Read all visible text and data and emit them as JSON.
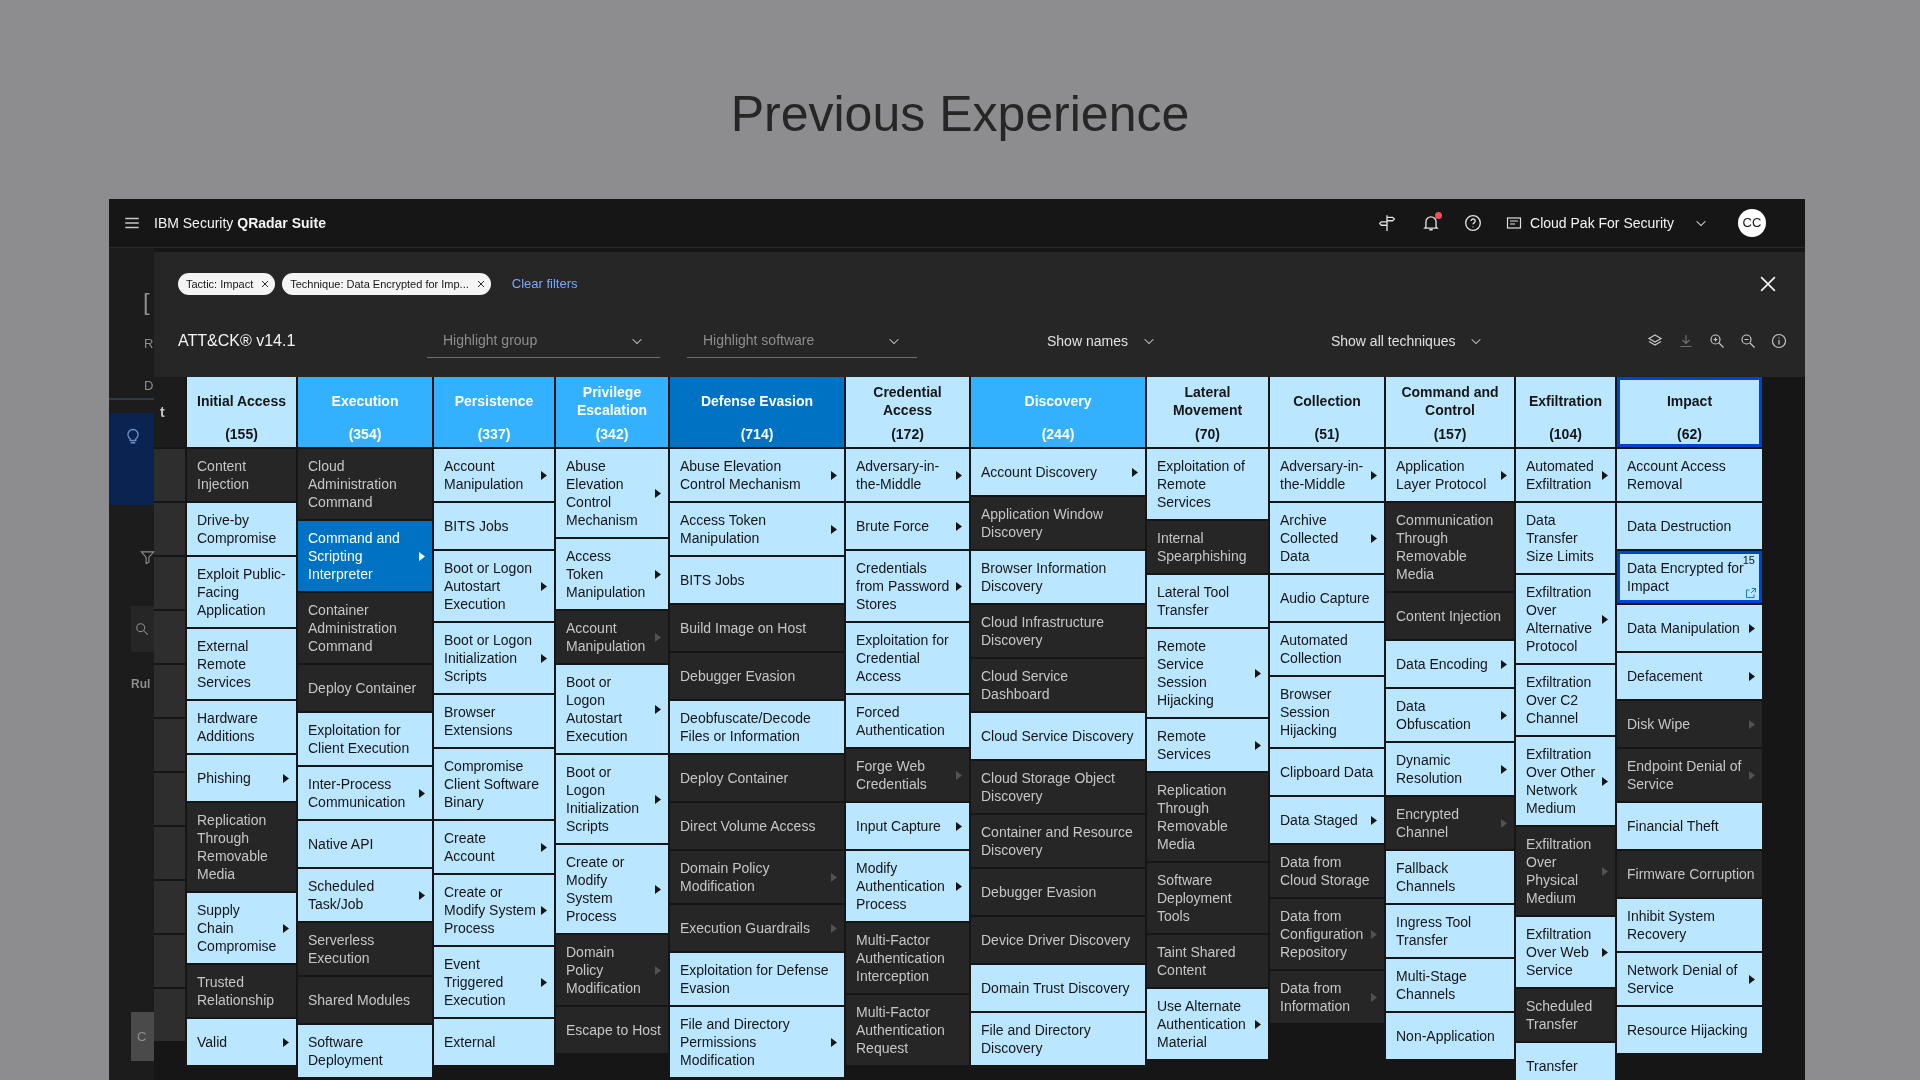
{
  "page_title": "Previous Experience",
  "app_bar": {
    "brand": "IBM Security **QRadar Suite**",
    "notification_unread": true,
    "context": "Cloud Pak For Security",
    "avatar": "CC"
  },
  "background_page": {
    "heading": "[",
    "label": "R",
    "tab": "D",
    "column_header": "Rul",
    "button": "C"
  },
  "filters": [
    {
      "label": "Tactic: Impact"
    },
    {
      "label": "Technique: Data Encrypted for Imp..."
    }
  ],
  "clear_filters": "Clear filters",
  "version": "ATT&CK® v14.1",
  "highlight_group": {
    "placeholder": "Highlight group"
  },
  "highlight_software": {
    "placeholder": "Highlight software"
  },
  "show_names": "Show names",
  "show_techniques": "Show all techniques",
  "cut_column_text": "t",
  "tactics": [
    {
      "name": "Initial Access",
      "count": "(155)",
      "color": "#bae6ff",
      "selected": false,
      "techniques": [
        {
          "name": "Content Injection",
          "color": "#262626",
          "selected": false,
          "has_sub": false
        },
        {
          "name": "Drive-by Compromise",
          "color": "#bae6ff",
          "selected": false,
          "has_sub": false
        },
        {
          "name": "Exploit Public-Facing Application",
          "color": "#bae6ff",
          "selected": false,
          "has_sub": false
        },
        {
          "name": "External Remote Services",
          "color": "#bae6ff",
          "selected": false,
          "has_sub": false
        },
        {
          "name": "Hardware Additions",
          "color": "#bae6ff",
          "selected": false,
          "has_sub": false
        },
        {
          "name": "Phishing",
          "color": "#bae6ff",
          "selected": false,
          "has_sub": true
        },
        {
          "name": "Replication Through Removable Media",
          "color": "#262626",
          "selected": false,
          "has_sub": false
        },
        {
          "name": "Supply Chain Compromise",
          "color": "#bae6ff",
          "selected": false,
          "has_sub": true
        },
        {
          "name": "Trusted Relationship",
          "color": "#262626",
          "selected": false,
          "has_sub": false
        },
        {
          "name": "Valid",
          "color": "#bae6ff",
          "selected": false,
          "has_sub": true
        }
      ]
    },
    {
      "name": "Execution",
      "count": "(354)",
      "color": "#33b1ff",
      "selected": false,
      "techniques": [
        {
          "name": "Cloud Administration Command",
          "color": "#262626",
          "selected": false,
          "has_sub": false
        },
        {
          "name": "Command and Scripting Interpreter",
          "color": "#0072c3",
          "selected": false,
          "has_sub": true
        },
        {
          "name": "Container Administration Command",
          "color": "#262626",
          "selected": false,
          "has_sub": false
        },
        {
          "name": "Deploy Container",
          "color": "#262626",
          "selected": false,
          "has_sub": false
        },
        {
          "name": "Exploitation for Client Execution",
          "color": "#bae6ff",
          "selected": false,
          "has_sub": false
        },
        {
          "name": "Inter-Process Communication",
          "color": "#bae6ff",
          "selected": false,
          "has_sub": true
        },
        {
          "name": "Native API",
          "color": "#bae6ff",
          "selected": false,
          "has_sub": false
        },
        {
          "name": "Scheduled Task/Job",
          "color": "#bae6ff",
          "selected": false,
          "has_sub": true
        },
        {
          "name": "Serverless Execution",
          "color": "#262626",
          "selected": false,
          "has_sub": false
        },
        {
          "name": "Shared Modules",
          "color": "#262626",
          "selected": false,
          "has_sub": false
        },
        {
          "name": "Software Deployment",
          "color": "#bae6ff",
          "selected": false,
          "has_sub": false
        }
      ]
    },
    {
      "name": "Persistence",
      "count": "(337)",
      "color": "#33b1ff",
      "selected": false,
      "techniques": [
        {
          "name": "Account Manipulation",
          "color": "#bae6ff",
          "selected": false,
          "has_sub": true
        },
        {
          "name": "BITS Jobs",
          "color": "#bae6ff",
          "selected": false,
          "has_sub": false
        },
        {
          "name": "Boot or Logon Autostart Execution",
          "color": "#bae6ff",
          "selected": false,
          "has_sub": true
        },
        {
          "name": "Boot or Logon Initialization Scripts",
          "color": "#bae6ff",
          "selected": false,
          "has_sub": true
        },
        {
          "name": "Browser Extensions",
          "color": "#bae6ff",
          "selected": false,
          "has_sub": false
        },
        {
          "name": "Compromise Client Software Binary",
          "color": "#bae6ff",
          "selected": false,
          "has_sub": false
        },
        {
          "name": "Create Account",
          "color": "#bae6ff",
          "selected": false,
          "has_sub": true
        },
        {
          "name": "Create or Modify System Process",
          "color": "#bae6ff",
          "selected": false,
          "has_sub": true
        },
        {
          "name": "Event Triggered Execution",
          "color": "#bae6ff",
          "selected": false,
          "has_sub": true
        },
        {
          "name": "External",
          "color": "#bae6ff",
          "selected": false,
          "has_sub": false
        }
      ]
    },
    {
      "name": "Privilege Escalation",
      "count": "(342)",
      "color": "#33b1ff",
      "selected": false,
      "techniques": [
        {
          "name": "Abuse Elevation Control Mechanism",
          "color": "#bae6ff",
          "selected": false,
          "has_sub": true
        },
        {
          "name": "Access Token Manipulation",
          "color": "#bae6ff",
          "selected": false,
          "has_sub": true
        },
        {
          "name": "Account Manipulation",
          "color": "#262626",
          "selected": false,
          "has_sub": true
        },
        {
          "name": "Boot or Logon Autostart Execution",
          "color": "#bae6ff",
          "selected": false,
          "has_sub": true
        },
        {
          "name": "Boot or Logon Initialization Scripts",
          "color": "#bae6ff",
          "selected": false,
          "has_sub": true
        },
        {
          "name": "Create or Modify System Process",
          "color": "#bae6ff",
          "selected": false,
          "has_sub": true
        },
        {
          "name": "Domain Policy Modification",
          "color": "#262626",
          "selected": false,
          "has_sub": true
        },
        {
          "name": "Escape to Host",
          "color": "#262626",
          "selected": false,
          "has_sub": false
        }
      ]
    },
    {
      "name": "Defense Evasion",
      "count": "(714)",
      "color": "#0072c3",
      "selected": false,
      "techniques": [
        {
          "name": "Abuse Elevation Control Mechanism",
          "color": "#bae6ff",
          "selected": false,
          "has_sub": true
        },
        {
          "name": "Access Token Manipulation",
          "color": "#bae6ff",
          "selected": false,
          "has_sub": true
        },
        {
          "name": "BITS Jobs",
          "color": "#bae6ff",
          "selected": false,
          "has_sub": false
        },
        {
          "name": "Build Image on Host",
          "color": "#262626",
          "selected": false,
          "has_sub": false
        },
        {
          "name": "Debugger Evasion",
          "color": "#262626",
          "selected": false,
          "has_sub": false
        },
        {
          "name": "Deobfuscate/Decode Files or Information",
          "color": "#bae6ff",
          "selected": false,
          "has_sub": false
        },
        {
          "name": "Deploy Container",
          "color": "#262626",
          "selected": false,
          "has_sub": false
        },
        {
          "name": "Direct Volume Access",
          "color": "#262626",
          "selected": false,
          "has_sub": false
        },
        {
          "name": "Domain Policy Modification",
          "color": "#262626",
          "selected": false,
          "has_sub": true
        },
        {
          "name": "Execution Guardrails",
          "color": "#262626",
          "selected": false,
          "has_sub": true
        },
        {
          "name": "Exploitation for Defense Evasion",
          "color": "#bae6ff",
          "selected": false,
          "has_sub": false
        },
        {
          "name": "File and Directory Permissions Modification",
          "color": "#bae6ff",
          "selected": false,
          "has_sub": true
        }
      ]
    },
    {
      "name": "Credential Access",
      "count": "(172)",
      "color": "#bae6ff",
      "selected": false,
      "techniques": [
        {
          "name": "Adversary-in-the-Middle",
          "color": "#bae6ff",
          "selected": false,
          "has_sub": true
        },
        {
          "name": "Brute Force",
          "color": "#bae6ff",
          "selected": false,
          "has_sub": true
        },
        {
          "name": "Credentials from Password Stores",
          "color": "#bae6ff",
          "selected": false,
          "has_sub": true
        },
        {
          "name": "Exploitation for Credential Access",
          "color": "#bae6ff",
          "selected": false,
          "has_sub": false
        },
        {
          "name": "Forced Authentication",
          "color": "#bae6ff",
          "selected": false,
          "has_sub": false
        },
        {
          "name": "Forge Web Credentials",
          "color": "#262626",
          "selected": false,
          "has_sub": true
        },
        {
          "name": "Input Capture",
          "color": "#bae6ff",
          "selected": false,
          "has_sub": true
        },
        {
          "name": "Modify Authentication Process",
          "color": "#bae6ff",
          "selected": false,
          "has_sub": true
        },
        {
          "name": "Multi-Factor Authentication Interception",
          "color": "#262626",
          "selected": false,
          "has_sub": false
        },
        {
          "name": "Multi-Factor Authentication Request",
          "color": "#262626",
          "selected": false,
          "has_sub": false
        }
      ]
    },
    {
      "name": "Discovery",
      "count": "(244)",
      "color": "#33b1ff",
      "selected": false,
      "techniques": [
        {
          "name": "Account Discovery",
          "color": "#bae6ff",
          "selected": false,
          "has_sub": true
        },
        {
          "name": "Application Window Discovery",
          "color": "#262626",
          "selected": false,
          "has_sub": false
        },
        {
          "name": "Browser Information Discovery",
          "color": "#bae6ff",
          "selected": false,
          "has_sub": false
        },
        {
          "name": "Cloud Infrastructure Discovery",
          "color": "#262626",
          "selected": false,
          "has_sub": false
        },
        {
          "name": "Cloud Service Dashboard",
          "color": "#262626",
          "selected": false,
          "has_sub": false
        },
        {
          "name": "Cloud Service Discovery",
          "color": "#bae6ff",
          "selected": false,
          "has_sub": false
        },
        {
          "name": "Cloud Storage Object Discovery",
          "color": "#262626",
          "selected": false,
          "has_sub": false
        },
        {
          "name": "Container and Resource Discovery",
          "color": "#262626",
          "selected": false,
          "has_sub": false
        },
        {
          "name": "Debugger Evasion",
          "color": "#262626",
          "selected": false,
          "has_sub": false
        },
        {
          "name": "Device Driver Discovery",
          "color": "#262626",
          "selected": false,
          "has_sub": false
        },
        {
          "name": "Domain Trust Discovery",
          "color": "#bae6ff",
          "selected": false,
          "has_sub": false
        },
        {
          "name": "File and Directory Discovery",
          "color": "#bae6ff",
          "selected": false,
          "has_sub": false
        }
      ]
    },
    {
      "name": "Lateral Movement",
      "count": "(70)",
      "color": "#bae6ff",
      "selected": false,
      "techniques": [
        {
          "name": "Exploitation of Remote Services",
          "color": "#bae6ff",
          "selected": false,
          "has_sub": false
        },
        {
          "name": "Internal Spearphishing",
          "color": "#262626",
          "selected": false,
          "has_sub": false
        },
        {
          "name": "Lateral Tool Transfer",
          "color": "#bae6ff",
          "selected": false,
          "has_sub": false
        },
        {
          "name": "Remote Service Session Hijacking",
          "color": "#bae6ff",
          "selected": false,
          "has_sub": true
        },
        {
          "name": "Remote Services",
          "color": "#bae6ff",
          "selected": false,
          "has_sub": true
        },
        {
          "name": "Replication Through Removable Media",
          "color": "#262626",
          "selected": false,
          "has_sub": false
        },
        {
          "name": "Software Deployment Tools",
          "color": "#262626",
          "selected": false,
          "has_sub": false
        },
        {
          "name": "Taint Shared Content",
          "color": "#262626",
          "selected": false,
          "has_sub": false
        },
        {
          "name": "Use Alternate Authentication Material",
          "color": "#bae6ff",
          "selected": false,
          "has_sub": true
        }
      ]
    },
    {
      "name": "Collection",
      "count": "(51)",
      "color": "#bae6ff",
      "selected": false,
      "techniques": [
        {
          "name": "Adversary-in-the-Middle",
          "color": "#bae6ff",
          "selected": false,
          "has_sub": true
        },
        {
          "name": "Archive Collected Data",
          "color": "#bae6ff",
          "selected": false,
          "has_sub": true
        },
        {
          "name": "Audio Capture",
          "color": "#bae6ff",
          "selected": false,
          "has_sub": false
        },
        {
          "name": "Automated Collection",
          "color": "#bae6ff",
          "selected": false,
          "has_sub": false
        },
        {
          "name": "Browser Session Hijacking",
          "color": "#bae6ff",
          "selected": false,
          "has_sub": false
        },
        {
          "name": "Clipboard Data",
          "color": "#bae6ff",
          "selected": false,
          "has_sub": false
        },
        {
          "name": "Data Staged",
          "color": "#bae6ff",
          "selected": false,
          "has_sub": true
        },
        {
          "name": "Data from Cloud Storage",
          "color": "#262626",
          "selected": false,
          "has_sub": false
        },
        {
          "name": "Data from Configuration Repository",
          "color": "#262626",
          "selected": false,
          "has_sub": true
        },
        {
          "name": "Data from Information",
          "color": "#262626",
          "selected": false,
          "has_sub": true
        }
      ]
    },
    {
      "name": "Command and Control",
      "count": "(157)",
      "color": "#bae6ff",
      "selected": false,
      "techniques": [
        {
          "name": "Application Layer Protocol",
          "color": "#bae6ff",
          "selected": false,
          "has_sub": true
        },
        {
          "name": "Communication Through Removable Media",
          "color": "#262626",
          "selected": false,
          "has_sub": false
        },
        {
          "name": "Content Injection",
          "color": "#262626",
          "selected": false,
          "has_sub": false
        },
        {
          "name": "Data Encoding",
          "color": "#bae6ff",
          "selected": false,
          "has_sub": true
        },
        {
          "name": "Data Obfuscation",
          "color": "#bae6ff",
          "selected": false,
          "has_sub": true
        },
        {
          "name": "Dynamic Resolution",
          "color": "#bae6ff",
          "selected": false,
          "has_sub": true
        },
        {
          "name": "Encrypted Channel",
          "color": "#262626",
          "selected": false,
          "has_sub": true
        },
        {
          "name": "Fallback Channels",
          "color": "#bae6ff",
          "selected": false,
          "has_sub": false
        },
        {
          "name": "Ingress Tool Transfer",
          "color": "#bae6ff",
          "selected": false,
          "has_sub": false
        },
        {
          "name": "Multi-Stage Channels",
          "color": "#bae6ff",
          "selected": false,
          "has_sub": false
        },
        {
          "name": "Non-Application",
          "color": "#bae6ff",
          "selected": false,
          "has_sub": false
        }
      ]
    },
    {
      "name": "Exfiltration",
      "count": "(104)",
      "color": "#bae6ff",
      "selected": false,
      "techniques": [
        {
          "name": "Automated Exfiltration",
          "color": "#bae6ff",
          "selected": false,
          "has_sub": true
        },
        {
          "name": "Data Transfer Size Limits",
          "color": "#bae6ff",
          "selected": false,
          "has_sub": false
        },
        {
          "name": "Exfiltration Over Alternative Protocol",
          "color": "#bae6ff",
          "selected": false,
          "has_sub": true
        },
        {
          "name": "Exfiltration Over C2 Channel",
          "color": "#bae6ff",
          "selected": false,
          "has_sub": false
        },
        {
          "name": "Exfiltration Over Other Network Medium",
          "color": "#bae6ff",
          "selected": false,
          "has_sub": true
        },
        {
          "name": "Exfiltration Over Physical Medium",
          "color": "#262626",
          "selected": false,
          "has_sub": true
        },
        {
          "name": "Exfiltration Over Web Service",
          "color": "#bae6ff",
          "selected": false,
          "has_sub": true
        },
        {
          "name": "Scheduled Transfer",
          "color": "#262626",
          "selected": false,
          "has_sub": false
        },
        {
          "name": "Transfer",
          "color": "#bae6ff",
          "selected": false,
          "has_sub": false
        }
      ]
    },
    {
      "name": "Impact",
      "count": "(62)",
      "color": "#bae6ff",
      "selected": true,
      "techniques": [
        {
          "name": "Account Access Removal",
          "color": "#bae6ff",
          "selected": false,
          "has_sub": false
        },
        {
          "name": "Data Destruction",
          "color": "#bae6ff",
          "selected": false,
          "has_sub": false
        },
        {
          "name": "Data Encrypted for Impact",
          "color": "#bae6ff",
          "selected": true,
          "has_sub": false,
          "count": "15"
        },
        {
          "name": "Data Manipulation",
          "color": "#bae6ff",
          "selected": false,
          "has_sub": true
        },
        {
          "name": "Defacement",
          "color": "#bae6ff",
          "selected": false,
          "has_sub": true
        },
        {
          "name": "Disk Wipe",
          "color": "#262626",
          "selected": false,
          "has_sub": true
        },
        {
          "name": "Endpoint Denial of Service",
          "color": "#262626",
          "selected": false,
          "has_sub": true
        },
        {
          "name": "Financial Theft",
          "color": "#bae6ff",
          "selected": false,
          "has_sub": false
        },
        {
          "name": "Firmware Corruption",
          "color": "#262626",
          "selected": false,
          "has_sub": false
        },
        {
          "name": "Inhibit System Recovery",
          "color": "#bae6ff",
          "selected": false,
          "has_sub": false
        },
        {
          "name": "Network Denial of Service",
          "color": "#bae6ff",
          "selected": false,
          "has_sub": true
        },
        {
          "name": "Resource Hijacking",
          "color": "#bae6ff",
          "selected": false,
          "has_sub": false
        }
      ]
    }
  ]
}
